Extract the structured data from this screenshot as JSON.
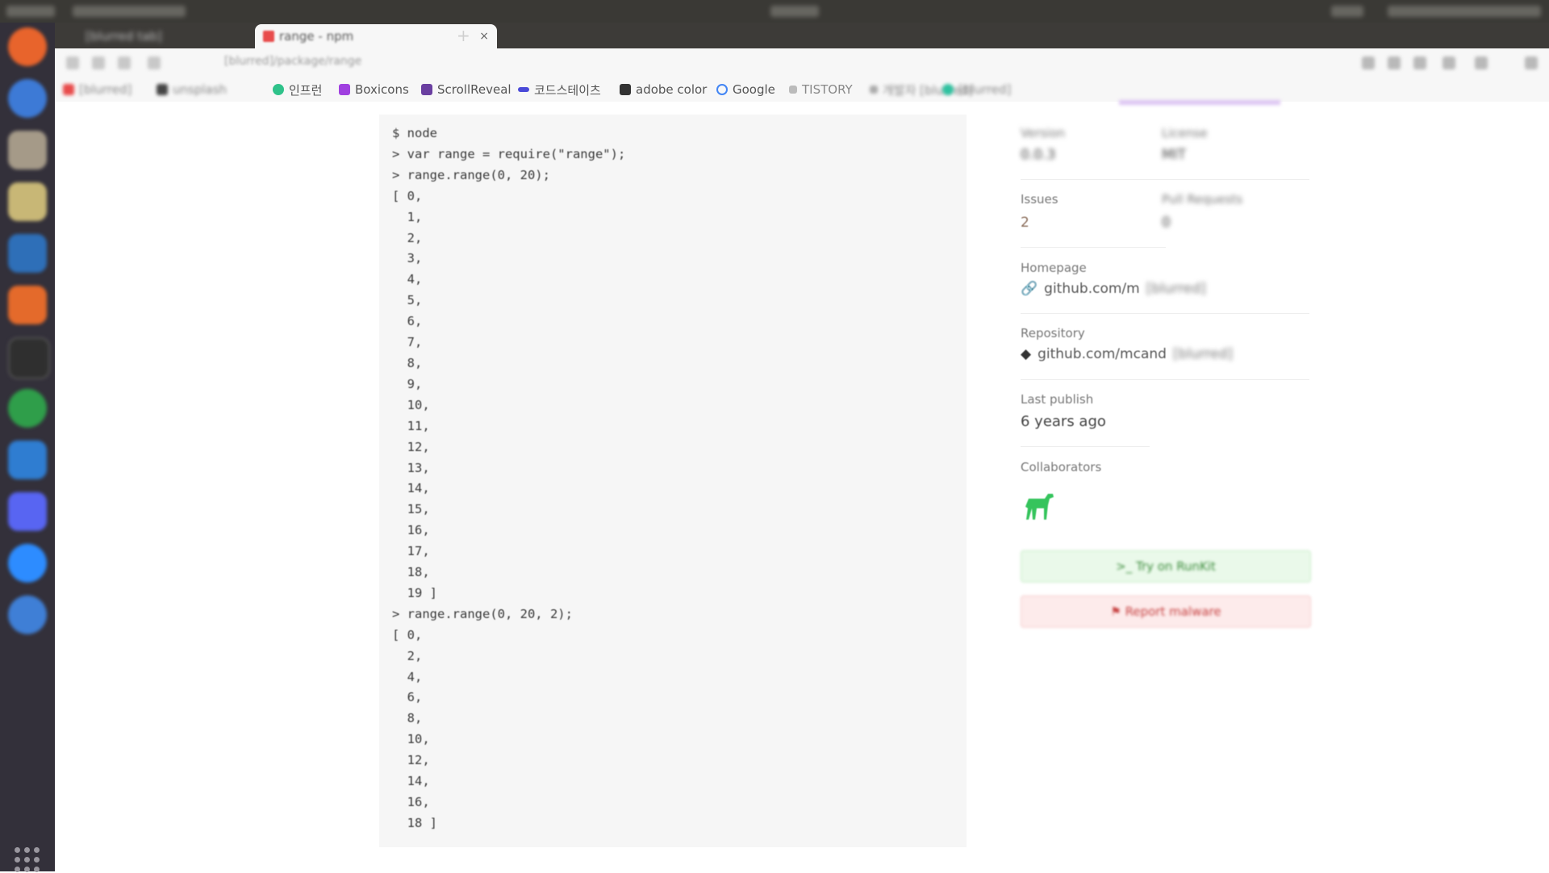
{
  "browser": {
    "tabs": [
      {
        "label": "[blurred tab]"
      },
      {
        "label": "range - npm"
      }
    ],
    "new_tab": "+",
    "close_tab": "×",
    "url": "[blurred]/package/range",
    "bookmarks": [
      {
        "label": "[blurred]",
        "color": "#e84b4b"
      },
      {
        "label": "unsplash",
        "color": "#444444"
      },
      {
        "label": "인프런",
        "color": "#2fc28a"
      },
      {
        "label": "Boxicons",
        "color": "#a040e0"
      },
      {
        "label": "ScrollReveal",
        "color": "#6a3fa0"
      },
      {
        "label": "코드스테이츠",
        "color": "#4a4ad8"
      },
      {
        "label": "adobe color",
        "color": "#333333"
      },
      {
        "label": "Google",
        "color": "#4285f4"
      },
      {
        "label": "TISTORY",
        "color": "#666666"
      },
      {
        "label": "개발자 [blurred]",
        "color": "#888888"
      },
      {
        "label": "[blurred]",
        "color": "#2ec2a0"
      }
    ]
  },
  "readme": {
    "code_lines": [
      "$ node",
      "> var range = require(\"range\");",
      "> range.range(0, 20);",
      "[ 0,",
      "  1,",
      "  2,",
      "  3,",
      "  4,",
      "  5,",
      "  6,",
      "  7,",
      "  8,",
      "  9,",
      "  10,",
      "  11,",
      "  12,",
      "  13,",
      "  14,",
      "  15,",
      "  16,",
      "  17,",
      "  18,",
      "  19 ]",
      "> range.range(0, 20, 2);",
      "[ 0,",
      "  2,",
      "  4,",
      "  6,",
      "  8,",
      "  10,",
      "  12,",
      "  14,",
      "  16,",
      "  18 ]"
    ]
  },
  "sidebar": {
    "version_label": "Version",
    "version_value": "0.0.3",
    "license_label": "License",
    "license_value": "MIT",
    "issues_label": "Issues",
    "issues_value": "2",
    "prs_label": "Pull Requests",
    "prs_value": "0",
    "homepage_label": "Homepage",
    "homepage_value": "github.com/m",
    "homepage_rest": "[blurred]",
    "repository_label": "Repository",
    "repository_value": "github.com/mcand",
    "repository_rest": "[blurred]",
    "last_publish_label": "Last publish",
    "last_publish_value": "6 years ago",
    "collaborators_label": "Collaborators",
    "try_button": "Try on RunKit",
    "report_button": "Report malware"
  }
}
